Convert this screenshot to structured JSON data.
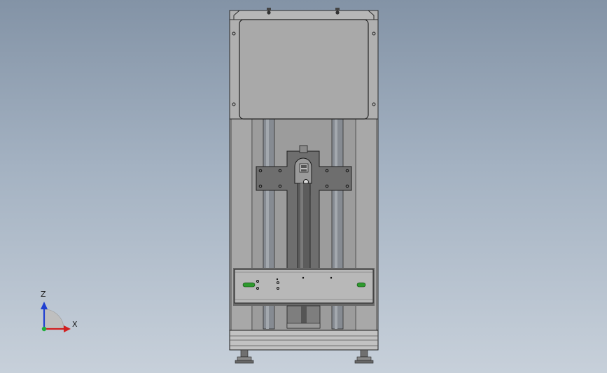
{
  "viewport": {
    "background_top": "#8393a6",
    "background_bottom": "#c7d0da"
  },
  "model": {
    "icon": "machine-assembly-model",
    "frame_color": "#a7a7a7",
    "panel_color": "#a9a9a9",
    "plate_color": "#6d6d6d",
    "rail_color": "#8a8f96",
    "indicator_color": "#2e9a2e"
  },
  "triad": {
    "icon": "coordinate-triad",
    "z_label": "Z",
    "x_label": "X",
    "z_color": "#1f3fd1",
    "x_color": "#d11f1f",
    "y_color": "#1fae3a"
  }
}
